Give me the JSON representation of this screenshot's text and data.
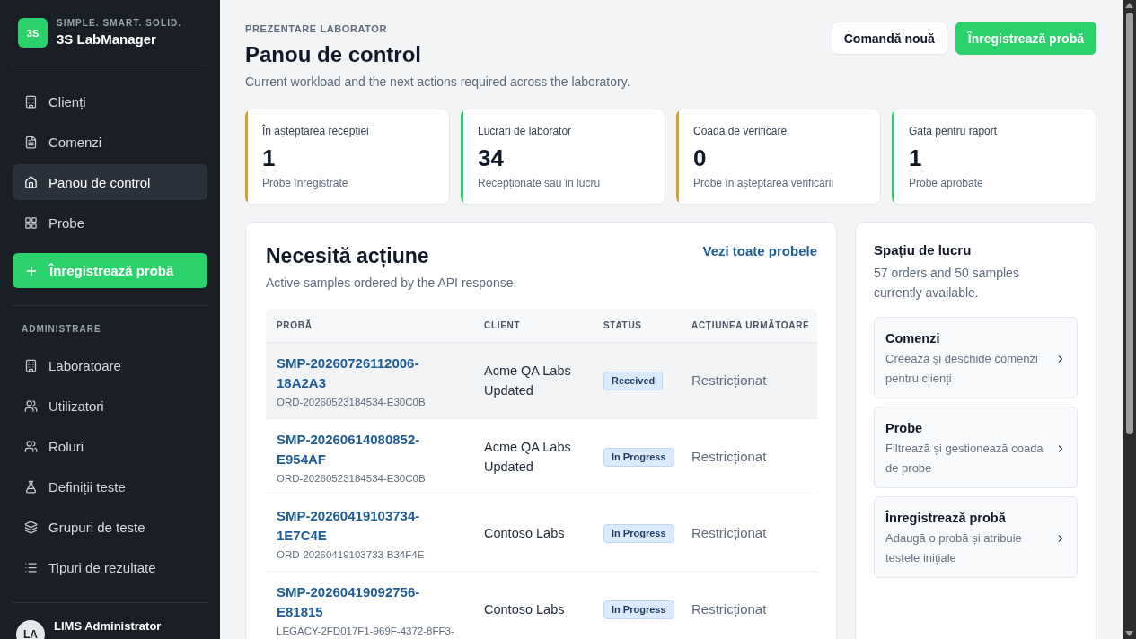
{
  "sidebar": {
    "brand": {
      "logo": "3S",
      "tagline": "SIMPLE. SMART. SOLID.",
      "name": "3S LabManager"
    },
    "nav": [
      {
        "label": "Clienți",
        "selected": false
      },
      {
        "label": "Comenzi",
        "selected": false
      },
      {
        "label": "Panou de control",
        "selected": true
      },
      {
        "label": "Probe",
        "selected": false
      }
    ],
    "action": "Înregistrează probă",
    "admin": {
      "title": "ADMINISTRARE",
      "items": [
        {
          "label": "Laboratoare",
          "selected": false
        },
        {
          "label": "Utilizatori",
          "selected": false
        },
        {
          "label": "Roluri",
          "selected": false
        },
        {
          "label": "Definiții teste",
          "selected": false
        },
        {
          "label": "Grupuri de teste",
          "selected": false
        },
        {
          "label": "Tipuri de rezultate",
          "selected": false
        }
      ]
    },
    "user": {
      "initials": "LA",
      "name": "LIMS Administrator"
    }
  },
  "header": {
    "eyebrow": "PREZENTARE LABORATOR",
    "title": "Panou de control",
    "subtitle": "Current workload and the next actions required across the laboratory.",
    "actions": [
      {
        "label": "Comandă nouă",
        "kind": "secondary"
      },
      {
        "label": "Înregistrează probă",
        "kind": "primary"
      }
    ]
  },
  "stats": [
    {
      "label": "În așteptarea recepției",
      "value": "1",
      "caption": "Probe înregistrate",
      "color": "#dc9a2c"
    },
    {
      "label": "Lucrări de laborator",
      "value": "34",
      "caption": "Recepționate sau în lucru",
      "color": "#2bd26b"
    },
    {
      "label": "Coada de verificare",
      "value": "0",
      "caption": "Probe în așteptarea verificării",
      "color": "#dc9a2c"
    },
    {
      "label": "Gata pentru raport",
      "value": "1",
      "caption": "Probe aprobate",
      "color": "#2bd26b"
    }
  ],
  "attention": {
    "title": "Necesită acțiune",
    "link": "Vezi toate probele",
    "subtitle": "Active samples ordered by the API response.",
    "columns": [
      "PROBĂ",
      "CLIENT",
      "STATUS",
      "ACȚIUNEA URMĂTOARE"
    ],
    "rows": [
      {
        "sample": "SMP-20260726112006-18A2A3",
        "order": "ORD-20260523184534-E30C0B",
        "client": "Acme QA Labs Updated",
        "status": "Received",
        "next_action": "Restricționat",
        "highlighted": true
      },
      {
        "sample": "SMP-20260614080852-E954AF",
        "order": "ORD-20260523184534-E30C0B",
        "client": "Acme QA Labs Updated",
        "status": "In Progress",
        "next_action": "Restricționat",
        "highlighted": false
      },
      {
        "sample": "SMP-20260419103734-1E7C4E",
        "order": "ORD-20260419103733-B34F4E",
        "client": "Contoso Labs",
        "status": "In Progress",
        "next_action": "Restricționat",
        "highlighted": false
      },
      {
        "sample": "SMP-20260419092756-E81815",
        "order": "LEGACY-2FD017F1-969F-4372-8FF3-",
        "client": "Contoso Labs",
        "status": "In Progress",
        "next_action": "Restricționat",
        "highlighted": false
      }
    ]
  },
  "workspace": {
    "title": "Spațiu de lucru",
    "summary": "57 orders and 50 samples currently available.",
    "links": [
      {
        "title": "Comenzi",
        "description": "Creează și deschide comenzi pentru clienți"
      },
      {
        "title": "Probe",
        "description": "Filtrează și gestionează coada de probe"
      },
      {
        "title": "Înregistrează probă",
        "description": "Adaugă o probă și atribuie testele inițiale"
      }
    ]
  }
}
